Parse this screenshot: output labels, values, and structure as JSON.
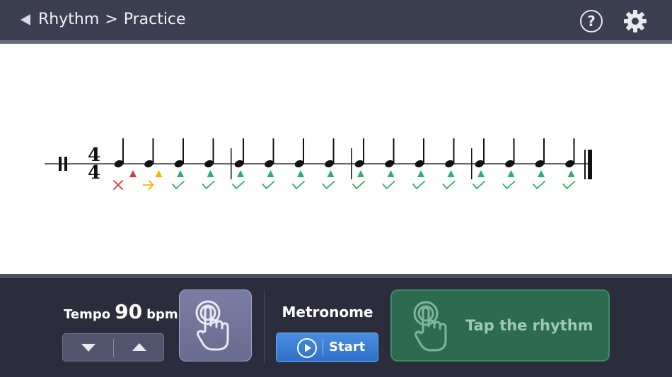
{
  "header": {
    "breadcrumb": [
      "Rhythm",
      ">",
      "Practice"
    ]
  },
  "icons": {
    "back": "back-triangle-icon",
    "help": "question-mark-icon",
    "help_glyph": "?",
    "settings": "gear-icon"
  },
  "score": {
    "time_signature": {
      "top": "4",
      "bottom": "4"
    },
    "measures": 4,
    "notes": [
      {
        "duration": "quarter",
        "result": "miss",
        "marker_color": "#d43a3a"
      },
      {
        "duration": "quarter",
        "result": "late",
        "marker_color": "#f2b705"
      },
      {
        "duration": "quarter",
        "result": "correct",
        "marker_color": "#2fae67"
      },
      {
        "duration": "quarter",
        "result": "correct",
        "marker_color": "#2fae67"
      },
      {
        "duration": "quarter",
        "result": "correct",
        "marker_color": "#2fae67"
      },
      {
        "duration": "quarter",
        "result": "correct",
        "marker_color": "#2fae67"
      },
      {
        "duration": "quarter",
        "result": "correct",
        "marker_color": "#2fae67"
      },
      {
        "duration": "quarter",
        "result": "correct",
        "marker_color": "#2fae67"
      },
      {
        "duration": "quarter",
        "result": "correct",
        "marker_color": "#2fae67"
      },
      {
        "duration": "quarter",
        "result": "correct",
        "marker_color": "#2fae67"
      },
      {
        "duration": "quarter",
        "result": "correct",
        "marker_color": "#2fae67"
      },
      {
        "duration": "quarter",
        "result": "correct",
        "marker_color": "#2fae67"
      },
      {
        "duration": "quarter",
        "result": "correct",
        "marker_color": "#2fae67"
      },
      {
        "duration": "quarter",
        "result": "correct",
        "marker_color": "#2fae67"
      },
      {
        "duration": "quarter",
        "result": "correct",
        "marker_color": "#2fae67"
      },
      {
        "duration": "quarter",
        "result": "correct",
        "marker_color": "#2fae67"
      }
    ]
  },
  "controls": {
    "tempo": {
      "label": "Tempo",
      "value": "90",
      "unit": "bpm"
    },
    "tap_tempo_icon": "tap-hand-icon",
    "metronome": {
      "label": "Metronome",
      "start_label": "Start"
    },
    "tap_rhythm": {
      "label": "Tap the rhythm"
    }
  },
  "colors": {
    "header_bg": "#3c3e52",
    "panel_bg": "#2b2d3d",
    "start_blue": "#3a7fd6",
    "tap_green": "#2c6b50",
    "miss_red": "#d43a3a",
    "late_yellow": "#f2b705",
    "correct_green": "#2fae67"
  }
}
